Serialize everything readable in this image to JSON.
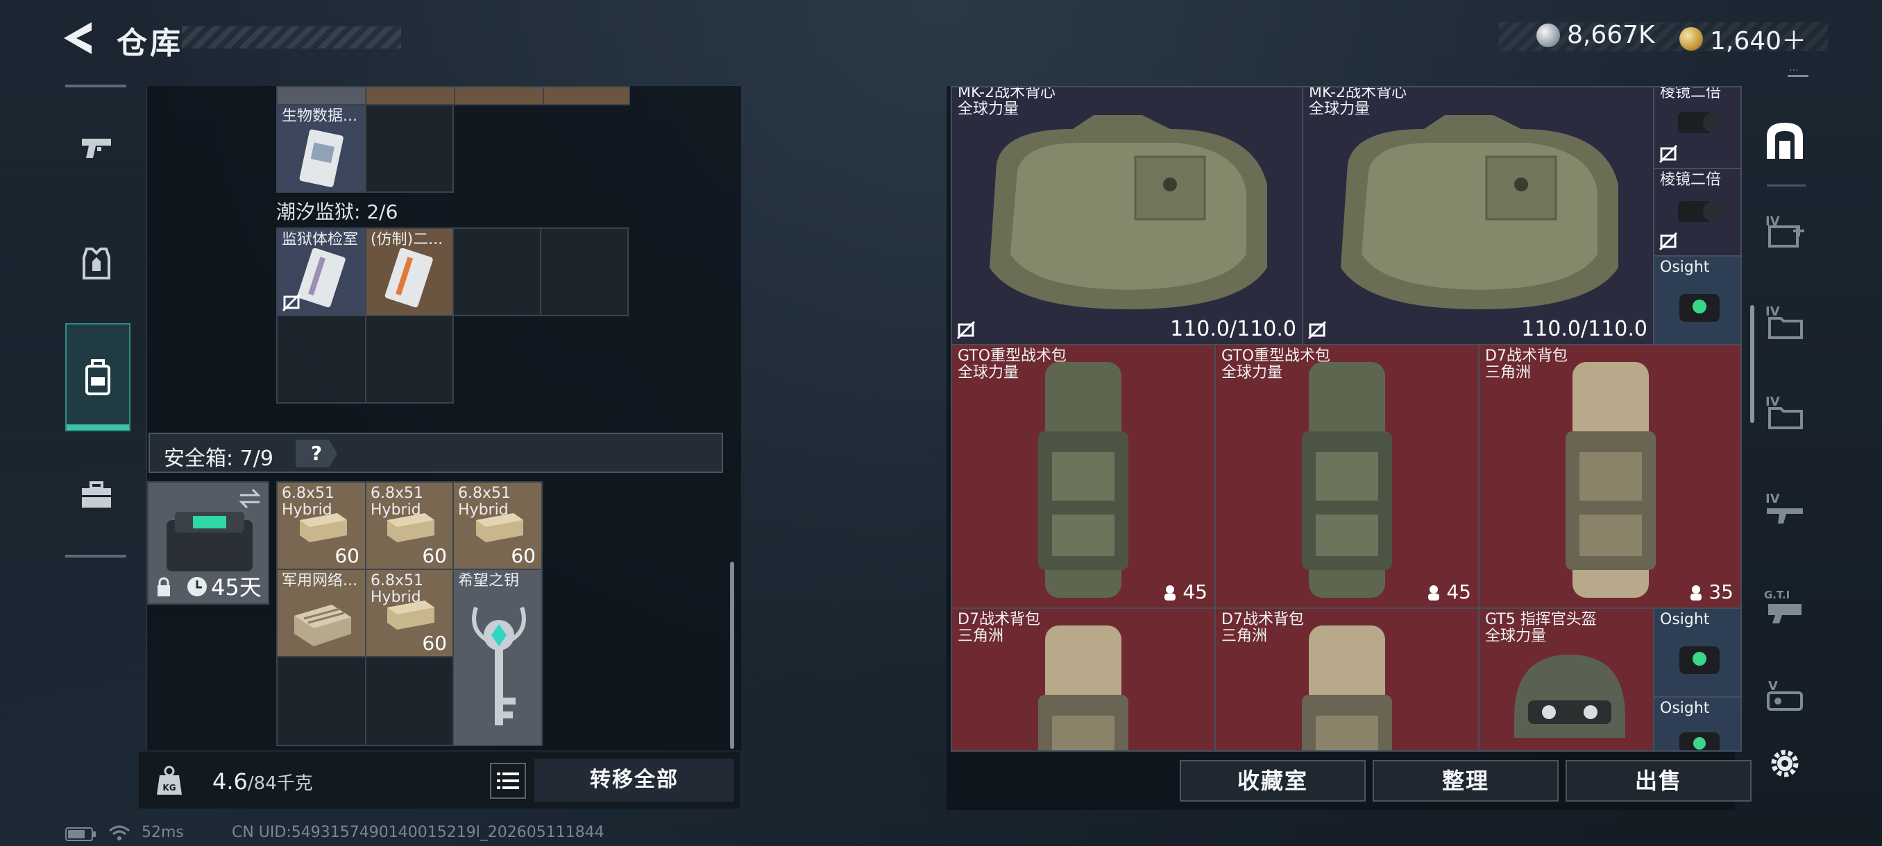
{
  "header": {
    "title": "仓库",
    "currencies": [
      {
        "icon": "silver-coin-icon",
        "value": "8,667K"
      },
      {
        "icon": "gold-coin-icon",
        "value": "1,640＋"
      }
    ],
    "version_mark": "..."
  },
  "left_nav": [
    {
      "icon": "pistol-icon",
      "active": false
    },
    {
      "icon": "armor-vest-icon",
      "active": false
    },
    {
      "icon": "backpack-icon",
      "active": true
    },
    {
      "icon": "toolbox-icon",
      "active": false
    }
  ],
  "stash": {
    "top_items": [
      {
        "name": "生物数据..."
      }
    ],
    "section_label": "潮汐监狱: 2/6",
    "section_items": [
      {
        "name": "监狱体检室"
      },
      {
        "name": "(仿制)二..."
      }
    ],
    "safebox": {
      "label": "安全箱: 7/9",
      "help": "?",
      "timer": "45天",
      "items": [
        {
          "name": "6.8x51",
          "sub": "Hybrid",
          "count": "60"
        },
        {
          "name": "6.8x51",
          "sub": "Hybrid",
          "count": "60"
        },
        {
          "name": "6.8x51",
          "sub": "Hybrid",
          "count": "60"
        },
        {
          "name": "军用网络...",
          "sub": "",
          "count": ""
        },
        {
          "name": "6.8x51",
          "sub": "Hybrid",
          "count": "60"
        },
        {
          "name": "希望之钥",
          "sub": "",
          "count": ""
        }
      ]
    },
    "weight": {
      "current": "4.6",
      "max": "/84千克"
    },
    "transfer_all": "转移全部"
  },
  "warehouse": {
    "items": [
      {
        "name": "MK-2战术背心",
        "sub": "全球力量",
        "durability": "110.0/110.0",
        "color": "dark"
      },
      {
        "name": "MK-2战术背心",
        "sub": "全球力量",
        "durability": "110.0/110.0",
        "color": "dark"
      },
      {
        "name": "棱镜二倍",
        "sub": "",
        "color": "dark"
      },
      {
        "name": "棱镜二倍",
        "sub": "",
        "color": "dark"
      },
      {
        "name": "Osight",
        "sub": "",
        "color": "blue"
      },
      {
        "name": "GTO重型战术包",
        "sub": "全球力量",
        "capacity": "45",
        "color": "red"
      },
      {
        "name": "GTO重型战术包",
        "sub": "全球力量",
        "capacity": "45",
        "color": "red"
      },
      {
        "name": "D7战术背包",
        "sub": "三角洲",
        "capacity": "35",
        "color": "red"
      },
      {
        "name": "D7战术背包",
        "sub": "三角洲",
        "color": "red"
      },
      {
        "name": "D7战术背包",
        "sub": "三角洲",
        "color": "red"
      },
      {
        "name": "GT5 指挥官头盔",
        "sub": "全球力量",
        "color": "red"
      },
      {
        "name": "Osight",
        "sub": "",
        "color": "blue"
      },
      {
        "name": "Osight",
        "sub": "",
        "color": "blue"
      }
    ],
    "buttons": {
      "collection": "收藏室",
      "sort": "整理",
      "sell": "出售"
    }
  },
  "right_tabs": [
    {
      "icon": "warehouse-icon",
      "label": ""
    },
    {
      "icon": "medkit-tab-icon",
      "label": "IV"
    },
    {
      "icon": "folder-tab-icon",
      "label": "IV"
    },
    {
      "icon": "folder-tab-icon-2",
      "label": "IV"
    },
    {
      "icon": "weapon-tab-icon",
      "label": "IV"
    },
    {
      "icon": "gti-tab-icon",
      "label": "G.T.I"
    },
    {
      "icon": "vehicle-tab-icon",
      "label": "V"
    },
    {
      "icon": "gear-icon",
      "label": ""
    }
  ],
  "status_bar": {
    "ping": "52ms",
    "uid": "CN UID:5493157490140015219l_202605111844"
  },
  "colors": {
    "accent_teal": "#39c3a4",
    "item_red": "#6e2a30",
    "item_dark": "#2a2b3f",
    "item_blue": "#2e3f55"
  }
}
